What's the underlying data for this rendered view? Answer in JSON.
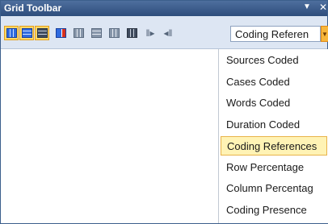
{
  "panel": {
    "title": "Grid Toolbar",
    "menu_glyph": "▼",
    "close_glyph": "✕"
  },
  "toolbar": {
    "tools": [
      {
        "name": "grid-blue-icon",
        "active": true
      },
      {
        "name": "grid-blue-rows-icon",
        "active": true
      },
      {
        "name": "grid-dark-icon",
        "active": true
      },
      {
        "name": "grid-highlight-icon",
        "active": false
      },
      {
        "name": "grid-gray-icon",
        "active": false
      },
      {
        "name": "grid-gray-icon",
        "active": false
      },
      {
        "name": "grid-columns-icon",
        "active": false
      },
      {
        "name": "grid-columns-dark-icon",
        "active": false
      },
      {
        "name": "shift-right-icon",
        "active": false
      },
      {
        "name": "shift-left-icon",
        "active": false
      }
    ],
    "combo_value": "Coding Referen"
  },
  "dropdown": {
    "selected_index": 4,
    "options": [
      "Sources Coded",
      "Cases Coded",
      "Words Coded",
      "Duration Coded",
      "Coding References",
      "Row Percentage",
      "Column Percentag",
      "Coding Presence"
    ]
  }
}
